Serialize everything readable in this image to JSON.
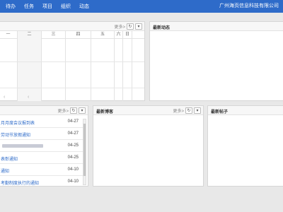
{
  "nav": {
    "items": [
      "待办",
      "任务",
      "项目",
      "组织",
      "动态"
    ],
    "company": "广州海页信息科技有限公司"
  },
  "calendar": {
    "more": "更多>",
    "days": [
      "一",
      "二",
      "三",
      "四",
      "五",
      "六",
      "日"
    ],
    "prev_arrow": "‹",
    "next_arrow": "‹"
  },
  "activity": {
    "title": "最新动态"
  },
  "notices": {
    "more": "更多>",
    "items": [
      {
        "title": "月月度会议报到表",
        "date": "04-27"
      },
      {
        "title": "劳动节放假通知",
        "date": "04-27"
      },
      {
        "title": "",
        "date": "04-25"
      },
      {
        "title": "表彰通知",
        "date": "04-25"
      },
      {
        "title": "通知",
        "date": "04-10"
      },
      {
        "title": "考勤制度执行的通知",
        "date": "04-10"
      }
    ]
  },
  "blogs": {
    "title": "最新博客",
    "more": "更多>"
  },
  "posts": {
    "title": "最新帖子"
  },
  "colors": {
    "topbar": "#2e6bc9",
    "link": "#2e6bc9"
  },
  "icons": {
    "refresh": "↻",
    "dropdown": "▾"
  }
}
